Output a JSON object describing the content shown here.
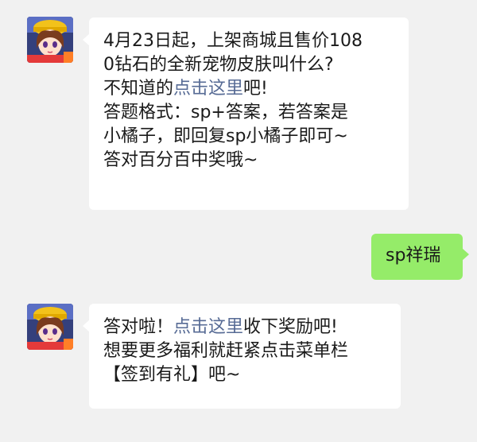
{
  "colors": {
    "background": "#f1f1f1",
    "bubble_left": "#ffffff",
    "bubble_right": "#95ec69",
    "link": "#576b95",
    "text": "#1a1a1a"
  },
  "messages": [
    {
      "side": "left",
      "avatar_icon": "game-character-avatar-icon",
      "lines": [
        {
          "parts": [
            {
              "text": "4月23日起，上架商城且售价108"
            }
          ]
        },
        {
          "parts": [
            {
              "text": "0钻石的全新宠物皮肤叫什么?"
            }
          ]
        },
        {
          "parts": [
            {
              "text": "不知道的"
            },
            {
              "text": "点击这里",
              "link": true
            },
            {
              "text": "吧!"
            }
          ]
        },
        {
          "parts": [
            {
              "text": "答题格式：sp+答案，若答案是"
            }
          ]
        },
        {
          "parts": [
            {
              "text": "小橘子，即回复sp小橘子即可~"
            }
          ]
        },
        {
          "parts": [
            {
              "text": "答对百分百中奖哦~"
            }
          ]
        }
      ]
    },
    {
      "side": "right",
      "text": "sp祥瑞"
    },
    {
      "side": "left",
      "avatar_icon": "game-character-avatar-icon",
      "lines": [
        {
          "parts": [
            {
              "text": "答对啦！"
            },
            {
              "text": "点击这里",
              "link": true
            },
            {
              "text": "收下奖励吧!"
            }
          ]
        },
        {
          "parts": [
            {
              "text": "想要更多福利就赶紧点击菜单栏"
            }
          ]
        },
        {
          "parts": [
            {
              "text": "【签到有礼】吧~"
            }
          ]
        }
      ]
    }
  ]
}
